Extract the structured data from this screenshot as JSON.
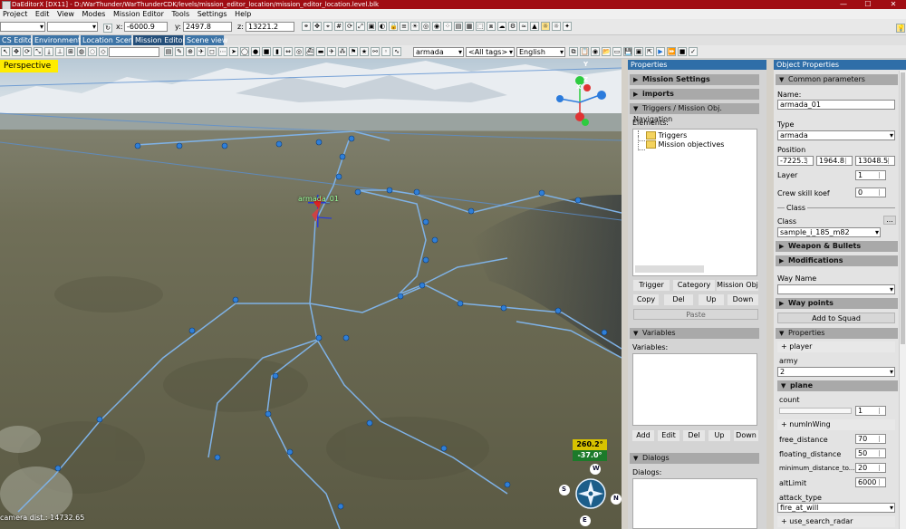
{
  "window": {
    "title": "DaEditorX  [DX11]  - D:/WarThunder/WarThunderCDK/levels/mission_editor_location/mission_editor_location.level.blk",
    "minimize": "—",
    "maximize": "☐",
    "close": "✕"
  },
  "menu": [
    "Project",
    "Edit",
    "View",
    "Modes",
    "Mission Editor",
    "Tools",
    "Settings",
    "Help"
  ],
  "toolbar1": {
    "x_label": "x:",
    "x_value": "-6000.9",
    "y_label": "y:",
    "y_value": "2497.8",
    "z_label": "z:",
    "z_value": "13221.2"
  },
  "tabs": [
    "CS Editor",
    "Environment",
    "Location Scene",
    "Mission Editor",
    "Scene view"
  ],
  "toolbar2": {
    "type_select": "armada",
    "tags_select": "<All tags>",
    "lang_select": "English"
  },
  "viewport": {
    "mode_label": "Perspective",
    "camera_distance": "camera dist.: 14732.65",
    "yaw": "260.2°",
    "pitch": "-37.0°",
    "unit_label": "armada_01",
    "gizmo": {
      "x": "X",
      "y": "Y",
      "z": "Z"
    },
    "compass": {
      "n": "N",
      "s": "S",
      "e": "E",
      "w": "W"
    },
    "colors": {
      "waypoint": "#2f7fd8",
      "route": "#7fb2e6",
      "mode_bg": "#ffec00"
    }
  },
  "properties": {
    "title": "Properties",
    "sections": {
      "mission_settings": "Mission Settings",
      "imports": "imports",
      "triggers": "Triggers / Mission Obj. Navigation",
      "variables": "Variables",
      "dialogs": "Dialogs"
    },
    "elements_label": "Elements:",
    "tree": [
      "Triggers",
      "Mission objectives"
    ],
    "trigger_buttons": [
      "Trigger",
      "Category",
      "Mission Obj"
    ],
    "edit_buttons": [
      "Copy",
      "Del",
      "Up",
      "Down"
    ],
    "paste": "Paste",
    "variables_label": "Variables:",
    "variables_buttons": [
      "Add",
      "Edit",
      "Del",
      "Up",
      "Down"
    ],
    "dialogs_label": "Dialogs:"
  },
  "object_properties": {
    "title": "Object Properties",
    "common": "Common parameters",
    "name_label": "Name:",
    "name_value": "armada_01",
    "type_label": "Type",
    "type_value": "armada",
    "position_label": "Position",
    "position": [
      "-7225.3",
      "1964.8",
      "13048.5"
    ],
    "layer_label": "Layer",
    "layer_value": "1",
    "crew_label": "Crew skill koef",
    "crew_value": "0",
    "class_divider": "Class",
    "class_label": "Class",
    "class_value": "sample_i_185_m82",
    "class_browse": "...",
    "weapons": "Weapon & Bullets",
    "modifications": "Modifications",
    "way_name_label": "Way Name",
    "way_name_value": "",
    "way_points": "Way points",
    "add_to_squad": "Add to Squad",
    "props_section": "Properties",
    "player": "+ player",
    "army_label": "army",
    "army_value": "2",
    "plane": "plane",
    "count_label": "count",
    "count_value": "1",
    "num_in_wing": "+ numInWing",
    "free_distance_label": "free_distance",
    "free_distance_value": "70",
    "floating_distance_label": "floating_distance",
    "floating_distance_value": "50",
    "min_distance_label": "minimum_distance_to...",
    "min_distance_value": "20",
    "alt_limit_label": "altLimit",
    "alt_limit_value": "6000",
    "attack_type_label": "attack_type",
    "attack_type_value": "fire_at_will",
    "use_search_radar": "+ use_search_radar"
  }
}
